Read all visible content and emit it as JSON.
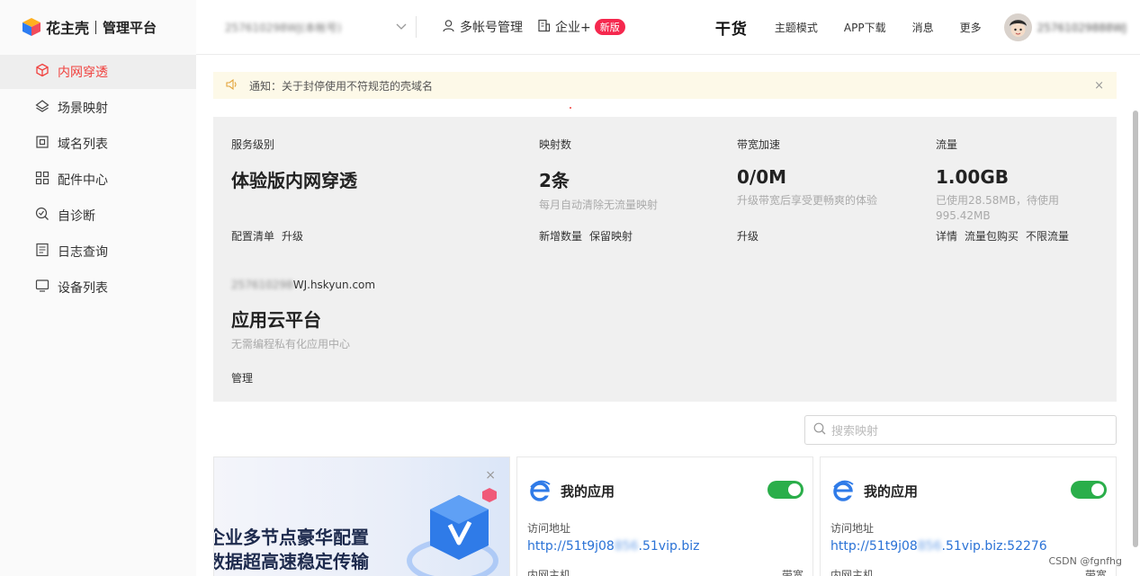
{
  "brand": {
    "name": "花主壳",
    "subtitle": "管理平台"
  },
  "header": {
    "account_value": "257610298WJ(本帐号)",
    "multi_account": "多帐号管理",
    "enterprise": "企业+",
    "enterprise_badge": "新版",
    "gan_huo": "干货",
    "links": [
      "主题模式",
      "APP下载",
      "消息",
      "更多"
    ],
    "user_name": "25761029888WJ"
  },
  "sidebar": {
    "items": [
      {
        "label": "内网穿透",
        "icon": "cube-icon",
        "active": true
      },
      {
        "label": "场景映射",
        "icon": "layers-icon"
      },
      {
        "label": "域名列表",
        "icon": "domain-icon"
      },
      {
        "label": "配件中心",
        "icon": "grid-icon"
      },
      {
        "label": "自诊断",
        "icon": "diagnose-icon"
      },
      {
        "label": "日志查询",
        "icon": "log-icon"
      },
      {
        "label": "设备列表",
        "icon": "monitor-icon"
      }
    ]
  },
  "notice": {
    "text": "通知：关于封停使用不符规范的壳域名",
    "close": "×"
  },
  "stats": {
    "service": {
      "label": "服务级别",
      "value": "体验版内网穿透",
      "links": [
        "配置清单",
        "升级"
      ]
    },
    "mapping": {
      "label": "映射数",
      "value": "2条",
      "desc": "每月自动清除无流量映射",
      "links": [
        "新增数量",
        "保留映射"
      ]
    },
    "bandwidth": {
      "label": "带宽加速",
      "value": "0/0M",
      "desc": "升级带宽后享受更畅爽的体验",
      "links": [
        "升级"
      ]
    },
    "traffic": {
      "label": "流量",
      "value": "1.00GB",
      "desc1": "已使用28.58MB，待使用",
      "desc2": "995.42MB",
      "links": [
        "详情",
        "流量包购买",
        "不限流量"
      ]
    },
    "cloud": {
      "domain_blur": "257610298",
      "domain_suffix": "WJ.hskyun.com",
      "value": "应用云平台",
      "desc": "无需编程私有化应用中心",
      "links": [
        "管理"
      ]
    }
  },
  "search": {
    "placeholder": "搜索映射"
  },
  "promo": {
    "line1": "企业多节点豪华配置",
    "line2": "数据超高速稳定传输",
    "close": "×"
  },
  "cards": [
    {
      "title": "我的应用",
      "access_label": "访问地址",
      "url_prefix": "http://51t9j08",
      "url_blur": "856",
      "url_suffix": ".51vip.biz",
      "host_label": "内网主机",
      "bandwidth_label": "带宽",
      "enabled": true
    },
    {
      "title": "我的应用",
      "access_label": "访问地址",
      "url_prefix": "http://51t9j08",
      "url_blur": "856",
      "url_suffix": ".51vip.biz:52276",
      "host_label": "内网主机",
      "bandwidth_label": "带宽",
      "enabled": true
    }
  ],
  "watermark": "CSDN @fgnfhg",
  "colors": {
    "accent": "#f0413e",
    "toggle_on": "#2aae4a",
    "link": "#2a72d6",
    "notice_bg": "#fdf9e8",
    "panel_bg": "#f0f0f0"
  }
}
